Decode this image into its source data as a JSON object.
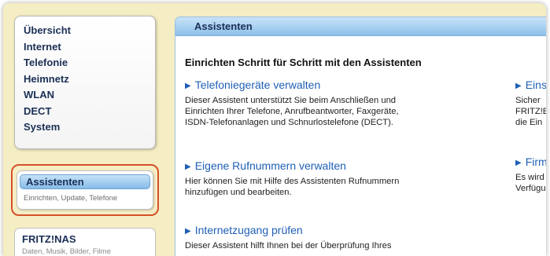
{
  "nav": {
    "items": [
      "Übersicht",
      "Internet",
      "Telefonie",
      "Heimnetz",
      "WLAN",
      "DECT",
      "System"
    ]
  },
  "assist_box": {
    "title": "Assistenten",
    "subtitle": "Einrichten, Update, Telefone"
  },
  "nas_box": {
    "title": "FRITZ!NAS",
    "subtitle": "Daten, Musik, Bilder, Filme"
  },
  "content": {
    "header": "Assistenten",
    "heading": "Einrichten Schritt für Schritt mit den Assistenten",
    "sections": [
      {
        "link": "Telefoniegeräte verwalten",
        "desc": [
          "Dieser Assistent unterstützt Sie beim Anschließen und",
          "Einrichten Ihrer Telefone, Anrufbeantworter, Faxgeräte,",
          "ISDN-Telefonanlagen und Schnurlostelefone (DECT)."
        ]
      },
      {
        "link": "Eigene Rufnummern verwalten",
        "desc": [
          "Hier können Sie mit Hilfe des Assistenten Rufnummern",
          "hinzufügen und bearbeiten."
        ]
      },
      {
        "link": "Internetzugang prüfen",
        "desc": [
          "Dieser Assistent hilft Ihnen bei der Überprüfung Ihres"
        ]
      },
      {
        "link": "Einste",
        "desc": [
          "Sicher",
          "FRITZ!E",
          "die Ein"
        ]
      },
      {
        "link": "Firmw",
        "desc": [
          "Es wird",
          "Verfügu"
        ]
      }
    ]
  },
  "colors": {
    "background": "#f5edc4",
    "link": "#1f5fb5",
    "nav_text": "#1b2f55",
    "highlight_ring": "#d6512a",
    "header_blue": "#8dc0ea"
  },
  "icons": {
    "link_arrow": "triangle-right-icon"
  }
}
